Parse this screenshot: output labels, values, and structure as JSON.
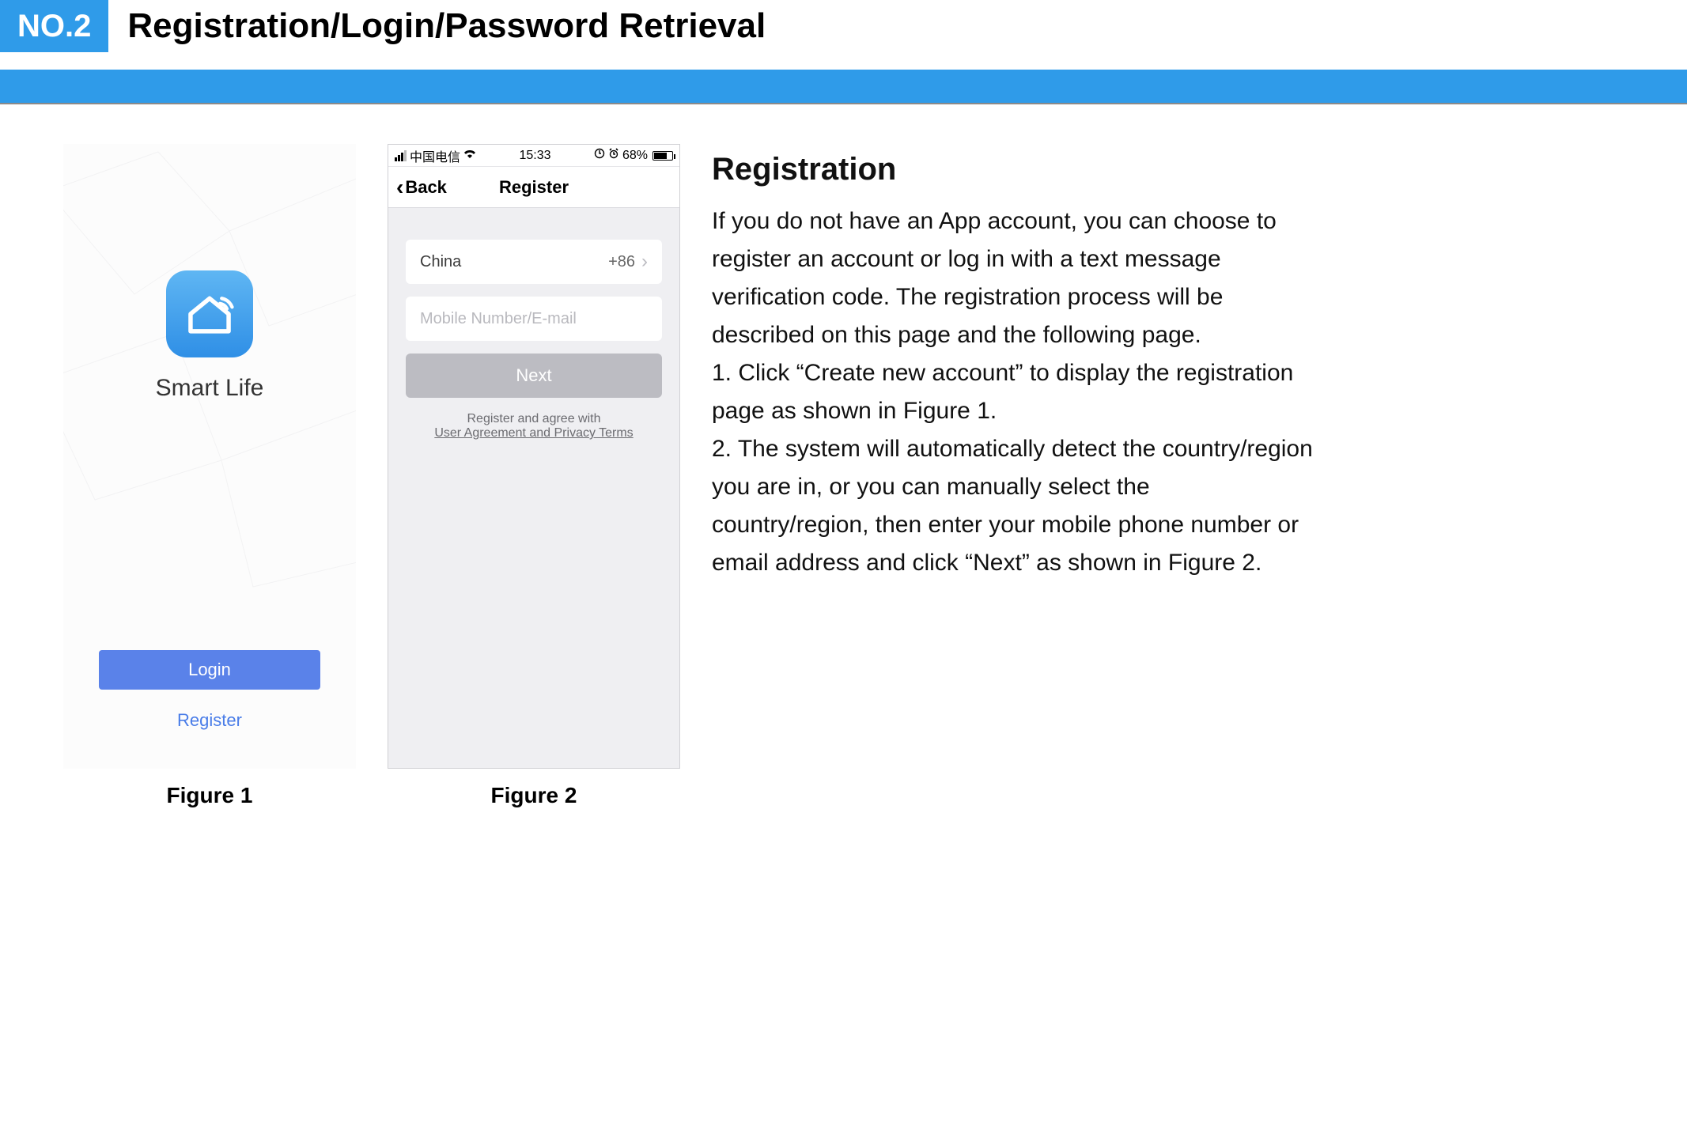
{
  "header": {
    "badge": "NO.2",
    "title": "Registration/Login/Password Retrieval"
  },
  "figure1": {
    "app_name": "Smart Life",
    "login_label": "Login",
    "register_label": "Register",
    "caption": "Figure 1"
  },
  "figure2": {
    "status": {
      "carrier": "中国电信",
      "time": "15:33",
      "battery_pct": "68%"
    },
    "nav": {
      "back_label": "Back",
      "title": "Register"
    },
    "country_field": {
      "name": "China",
      "code": "+86"
    },
    "input_placeholder": "Mobile Number/E-mail",
    "next_label": "Next",
    "agree_line1": "Register and agree with",
    "agree_link": "User Agreement and Privacy Terms",
    "caption": "Figure 2"
  },
  "instructions": {
    "heading": "Registration",
    "body": "If you do not have an App account, you can choose to register an account or log in with a text message verification code. The registration process will be described on this page and the following page.\n1. Click “Create new account” to display the registration page as shown in Figure 1.\n2. The system will automatically detect  the country/region you are in, or you can manually select the country/region, then enter your mobile phone number or email address and click “Next” as shown in Figure 2."
  }
}
